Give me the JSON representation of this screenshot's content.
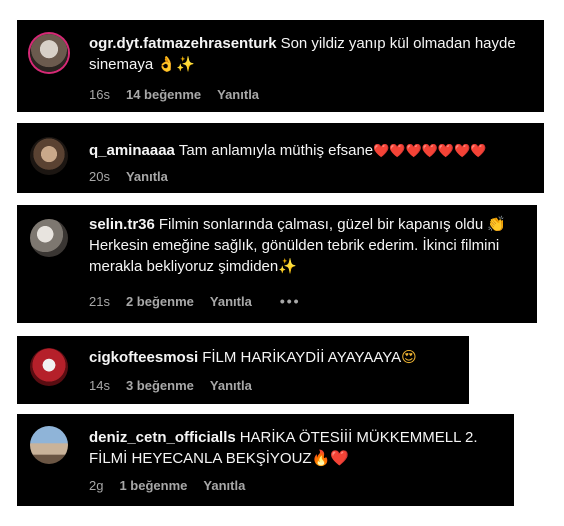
{
  "comments": [
    {
      "username": "ogr.dyt.fatmazehrasenturk",
      "text": "Son yildiz yanıp kül olmadan hayde sinemaya",
      "emoji": "👌✨",
      "time": "16s",
      "likes": "14 beğenme",
      "reply": "Yanıtla"
    },
    {
      "username": "q_aminaaaa",
      "text": "Tam anlamıyla müthiş efsane",
      "emoji": "❤️❤️❤️❤️❤️❤️❤️",
      "time": "20s",
      "reply": "Yanıtla"
    },
    {
      "username": "selin.tr36",
      "text": "Filmin sonlarında çalması, güzel bir kapanış oldu",
      "emoji_clap": "👏",
      "text2": "Herkesin emeğine sağlık, gönülden tebrik ederim. İkinci filmini merakla bekliyoruz şimdiden",
      "emoji": "✨",
      "time": "21s",
      "likes": "2 beğenme",
      "reply": "Yanıtla",
      "more": "•••"
    },
    {
      "username": "cigkofteesmosi",
      "text": "FİLM HARİKAYDİİ AYAYAAYA",
      "emoji": "😍",
      "time": "14s",
      "likes": "3 beğenme",
      "reply": "Yanıtla"
    },
    {
      "username": "deniz_cetn_officialls",
      "text": "HARİKA ÖTESİİİ MÜKKEMMELL 2. FİLMİ HEYECANLA BEKŞİYOUZ",
      "emoji": "🔥❤️",
      "time": "2g",
      "likes": "1 beğenme",
      "reply": "Yanıtla"
    }
  ],
  "colors": {
    "card_bg": "#000000",
    "text": "#f5f5f5",
    "meta": "#a8a8a8",
    "heart": "#ed4956"
  }
}
